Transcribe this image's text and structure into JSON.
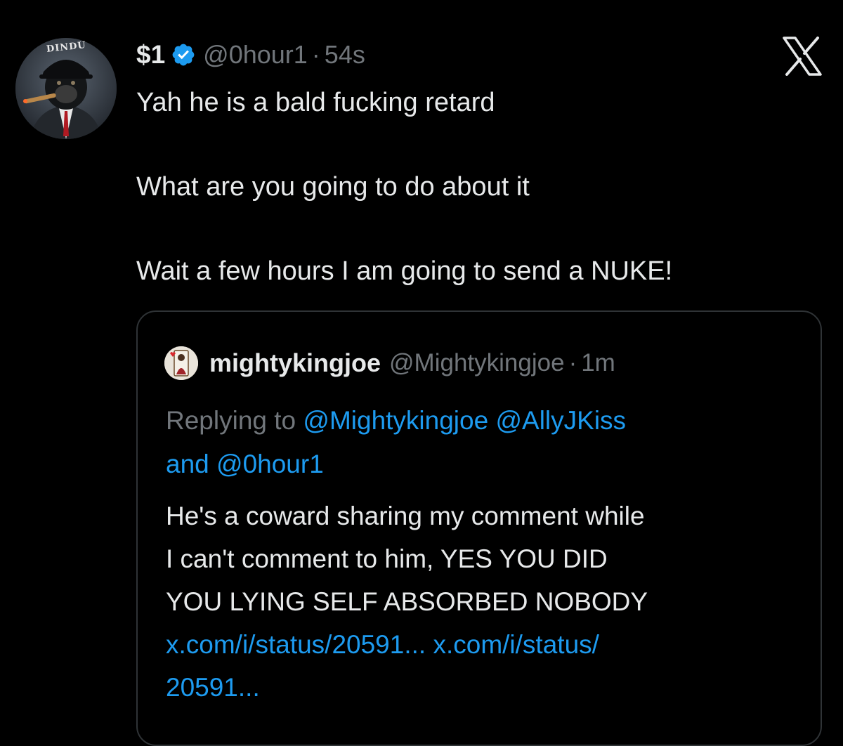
{
  "tweet": {
    "display_name": "$1",
    "handle": "@0hour1",
    "separator": "·",
    "time": "54s",
    "avatar_caption": "DINDU",
    "verified_icon": "verified-badge-icon",
    "text_lines": [
      "Yah he is a bald fucking retard",
      "What are you going to do about it",
      "Wait a few hours I am going to send a NUKE!"
    ]
  },
  "quoted": {
    "display_name": "mightykingjoe",
    "handle": "@Mightykingjoe",
    "separator": "·",
    "time": "1m",
    "reply_prefix": "Replying to",
    "reply_mention_1": "@Mightykingjoe",
    "reply_mention_2": "@AllyJKiss",
    "reply_and": "and",
    "reply_mention_3": "@0hour1",
    "body_lines": [
      "He's a coward sharing my comment while",
      "I can't comment to him, YES YOU DID",
      "YOU LYING SELF ABSORBED NOBODY"
    ],
    "link_1": "x.com/i/status/20591...",
    "link_2a": "x.com/i/status/",
    "link_2b": "20591..."
  },
  "colors": {
    "background": "#000000",
    "text_primary": "#e7e9ea",
    "text_secondary": "#71767b",
    "link": "#1d9bf0",
    "verified": "#1d9bf0",
    "border": "#2f3336"
  },
  "icons": {
    "close": "x-logo-icon",
    "verified": "verified-badge-icon"
  }
}
